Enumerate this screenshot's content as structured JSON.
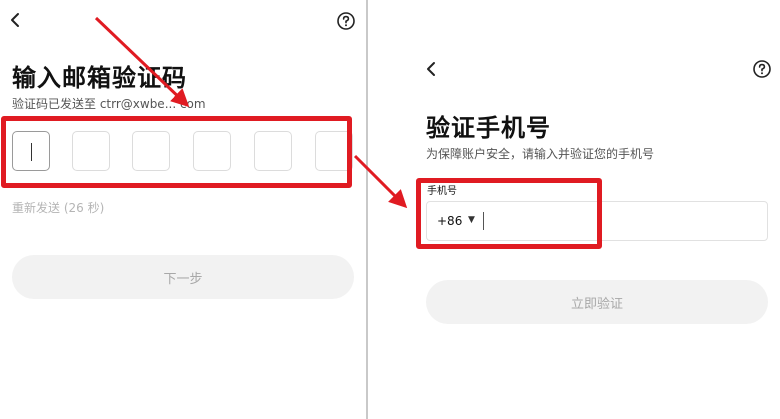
{
  "left_screen": {
    "title": "输入邮箱验证码",
    "subtitle": "验证码已发送至 ctrr@xwbe... com",
    "code_boxes": 6,
    "resend_text": "重新发送 (26 秒)",
    "next_button": "下一步"
  },
  "right_screen": {
    "title": "验证手机号",
    "subtitle": "为保障账户安全，请输入并验证您的手机号",
    "phone_label": "手机号",
    "country_code": "+86",
    "verify_button": "立即验证"
  },
  "icons": {
    "back": "chevron-left-icon",
    "help": "question-circle-icon",
    "dropdown": "caret-down-icon"
  },
  "colors": {
    "annotation": "#e01b22",
    "button_bg": "#f2f2f2",
    "button_text": "#a8a8a8"
  }
}
